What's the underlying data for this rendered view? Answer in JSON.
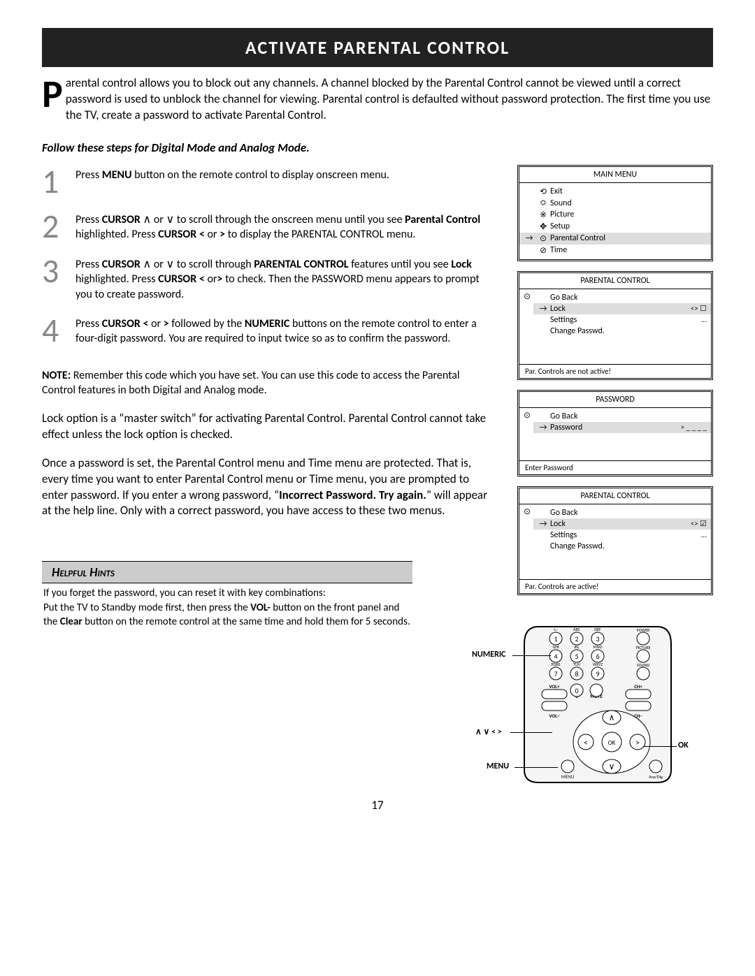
{
  "title": "ACTIVATE PARENTAL CONTROL",
  "intro": "arental control allows you to block out any channels. A channel blocked by the Parental Control cannot be viewed until a correct password is used to unblock the channel for viewing. Parental control is defaulted without password protection. The first time you use the TV, create a password to activate Parental Control.",
  "dropcap": "P",
  "subhead": "Follow these steps for Digital Mode and Analog Mode.",
  "steps": [
    {
      "n": "1",
      "html": "Press <b>MENU</b> button on the remote control to display onscreen menu."
    },
    {
      "n": "2",
      "html": "Press <b>CURSOR</b> &#8743; or &#8744; to scroll through the onscreen menu until you see <b>Parental Control</b> highlighted. Press <b>CURSOR &lt;</b> or <b>&gt;</b> to display the PARENTAL CONTROL menu."
    },
    {
      "n": "3",
      "html": "Press <b>CURSOR</b> &#8743; or &#8744; to scroll through <b>PARENTAL CONTROL</b> features until you see <b>Lock</b> highlighted. Press <b>CURSOR &lt;</b> or<b>&gt;</b> to check. Then the PASSWORD menu appears to prompt you to create password."
    },
    {
      "n": "4",
      "html": "Press <b>CURSOR &lt;</b> or <b>&gt;</b> followed by the <b>NUMERIC</b> buttons on the remote control to enter a four-digit password. You are required to input twice so as to confirm the password."
    }
  ],
  "note": "<b>NOTE:</b> Remember this code which you have set. You can use this code to access the Parental Control features in both Digital and Analog mode.",
  "para1": "Lock option is a “master switch” for activating Parental Control. Parental Control cannot take effect unless the lock option is checked.",
  "para2_html": "Once a password is set, the Parental Control menu and Time menu are protected. That is, every time you want to enter Parental Control menu or Time menu, you are prompted to enter password. If you enter a wrong password, “<b>Incorrect Password. Try again.</b>” will appear at the help line. Only with a correct password, you have access to these two menus.",
  "hints_title": "Helpful Hints",
  "hints_html": "If you forget the password, you can reset it with key combinations:<br>Put the TV to Standby mode first, then press the <b>VOL-</b> button on the front panel and the <b>Clear</b> button on the remote control at the same time and hold them for 5 seconds.",
  "osd1": {
    "title": "MAIN MENU",
    "rows": [
      {
        "arrow": "",
        "icon": "⟲",
        "label": "Exit",
        "right": ""
      },
      {
        "arrow": "",
        "icon": "☼",
        "label": "Sound",
        "right": ""
      },
      {
        "arrow": "",
        "icon": "※",
        "label": "Picture",
        "right": ""
      },
      {
        "arrow": "",
        "icon": "✥",
        "label": "Setup",
        "right": ""
      },
      {
        "arrow": "→",
        "icon": "⊙",
        "label": "Parental Control",
        "right": "",
        "sel": true
      },
      {
        "arrow": "",
        "icon": "⊘",
        "label": "Time",
        "right": ""
      }
    ]
  },
  "osd2": {
    "title": "PARENTAL CONTROL",
    "eye": true,
    "rows": [
      {
        "arrow": "",
        "label": "Go Back",
        "right": ""
      },
      {
        "arrow": "→",
        "label": "Lock",
        "right": "<> ☐",
        "sel": true
      },
      {
        "arrow": "",
        "label": "Settings",
        "right": "..."
      },
      {
        "arrow": "",
        "label": "Change Passwd.",
        "right": ""
      }
    ],
    "foot": "Par. Controls are not active!"
  },
  "osd3": {
    "title": "PASSWORD",
    "eye": true,
    "rows": [
      {
        "arrow": "",
        "label": "Go Back",
        "right": ""
      },
      {
        "arrow": "→",
        "label": "Password",
        "right": "> _ _ _ _",
        "sel": true
      }
    ],
    "foot": "Enter Password"
  },
  "osd4": {
    "title": "PARENTAL CONTROL",
    "eye": true,
    "rows": [
      {
        "arrow": "",
        "label": "Go Back",
        "right": ""
      },
      {
        "arrow": "→",
        "label": "Lock",
        "right": "<> ☑",
        "sel": true
      },
      {
        "arrow": "",
        "label": "Settings",
        "right": "..."
      },
      {
        "arrow": "",
        "label": "Change Passwd.",
        "right": ""
      }
    ],
    "foot": "Par. Controls are active!"
  },
  "remote_labels": {
    "numeric": "NUMERIC",
    "arrows": "∧ ∨ < >",
    "menu": "MENU",
    "ok": "OK"
  },
  "remote_btns": {
    "row1": [
      "+.-",
      "ABC",
      "DEF",
      "POWER"
    ],
    "row2": [
      "GHI",
      "JKL",
      "MNO",
      "PICTURE"
    ],
    "row3": [
      "PQRS",
      "TUV",
      "WXYZ",
      "SOUND"
    ],
    "nums": [
      "1",
      "2",
      "3",
      "4",
      "5",
      "6",
      "7",
      "8",
      "9",
      "0"
    ],
    "vol_plus": "VOL+",
    "vol_minus": "VOL−",
    "mute": "MUTE",
    "ch_plus": "CH+",
    "ch_minus": "CH−",
    "ok": "OK",
    "menu": "MENU",
    "anadig": "Ana/Dig"
  },
  "pagenum": "17"
}
